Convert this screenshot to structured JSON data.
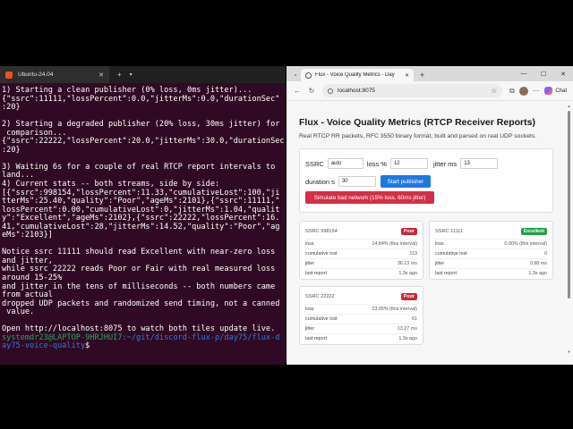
{
  "terminal": {
    "tab_title": "Ubuntu-24.04",
    "lines": [
      "1) Starting a clean publisher (0% loss, 0ms jitter)...",
      "{\"ssrc\":11111,\"lossPercent\":0.0,\"jitterMs\":0.0,\"durationSec\"",
      ":20}",
      "",
      "2) Starting a degraded publisher (20% loss, 30ms jitter) for",
      " comparison...",
      "{\"ssrc\":22222,\"lossPercent\":20.0,\"jitterMs\":30.0,\"durationSec\"",
      ":20}",
      "",
      "3) Waiting 6s for a couple of real RTCP report intervals to",
      "land...",
      "4) Current stats -- both streams, side by side:",
      "[{\"ssrc\":998154,\"lossPercent\":11.33,\"cumulativeLost\":100,\"ji",
      "tterMs\":25.40,\"quality\":\"Poor\",\"ageMs\":2101},{\"ssrc\":11111,\"",
      "lossPercent\":0.00,\"cumulativeLost\":0,\"jitterMs\":1.04,\"qualit",
      "y\":\"Excellent\",\"ageMs\":2102},{\"ssrc\":22222,\"lossPercent\":16.",
      "41,\"cumulativeLost\":28,\"jitterMs\":14.52,\"quality\":\"Poor\",\"ag",
      "eMs\":2103}]",
      "",
      "Notice ssrc 11111 should read Excellent with near-zero loss",
      "and jitter,",
      "while ssrc 22222 reads Poor or Fair with real measured loss",
      "around 15-25%",
      "and jitter in the tens of milliseconds -- both numbers came",
      "from actual",
      "dropped UDP packets and randomized send timing, not a canned",
      " value.",
      "",
      "Open http://localhost:8075 to watch both tiles update live."
    ],
    "prompt_user": "systemdr23@LAPTOP-9HRJHUI7",
    "prompt_path": ":~/git/discord-flux-p/day75/flux-d",
    "prompt_path2": "ay75-voice-quality",
    "prompt_symbol": "$"
  },
  "browser": {
    "tab_title": "Flux - Voice Quality Metrics - Day",
    "url": "localhost:8075",
    "chat_label": "Chat"
  },
  "page": {
    "title": "Flux - Voice Quality Metrics (RTCP Receiver Reports)",
    "subtitle": "Real RTCP RR packets, RFC 3550 binary format, built and parsed on real UDP sockets.",
    "controls": {
      "ssrc_label": "SSRC",
      "ssrc_value": "auto",
      "loss_label": "loss %",
      "loss_value": "12",
      "jitter_label": "jitter ms",
      "jitter_value": "13",
      "duration_label": "duration s",
      "duration_value": "30",
      "start_button": "Start publisher",
      "bad_network_button": "Simulate bad network (15% loss, 60ms jitter)"
    },
    "tiles": [
      {
        "name": "SSRC 998154",
        "badge": "Poor",
        "rows": [
          {
            "k": "loss",
            "v": "14.84% (this interval)"
          },
          {
            "k": "cumulative lost",
            "v": "113"
          },
          {
            "k": "jitter",
            "v": "36.13 ms"
          },
          {
            "k": "last report",
            "v": "1.3s ago"
          }
        ]
      },
      {
        "name": "SSRC 11111",
        "badge": "Excellent",
        "rows": [
          {
            "k": "loss",
            "v": "0.00% (this interval)"
          },
          {
            "k": "cumulative lost",
            "v": "0"
          },
          {
            "k": "jitter",
            "v": "0.98 ms"
          },
          {
            "k": "last report",
            "v": "1.3s ago"
          }
        ]
      },
      {
        "name": "SSRC 22222",
        "badge": "Poor",
        "rows": [
          {
            "k": "loss",
            "v": "23.05% (this interval)"
          },
          {
            "k": "cumulative lost",
            "v": "61"
          },
          {
            "k": "jitter",
            "v": "13.27 ms"
          },
          {
            "k": "last report",
            "v": "1.3s ago"
          }
        ]
      }
    ]
  },
  "colors": {
    "terminal_bg": "#300a24",
    "prompt_user": "#26a269",
    "prompt_path": "#2a7bde",
    "accent_blue": "#1f78e0",
    "danger_red": "#d32f45",
    "poor_badge": "#c62839",
    "excellent_badge": "#22a04e"
  },
  "icons": {
    "terminal_tab": "ubuntu-logo-icon",
    "browser_tab": "globe-icon",
    "lock": "info-icon"
  }
}
